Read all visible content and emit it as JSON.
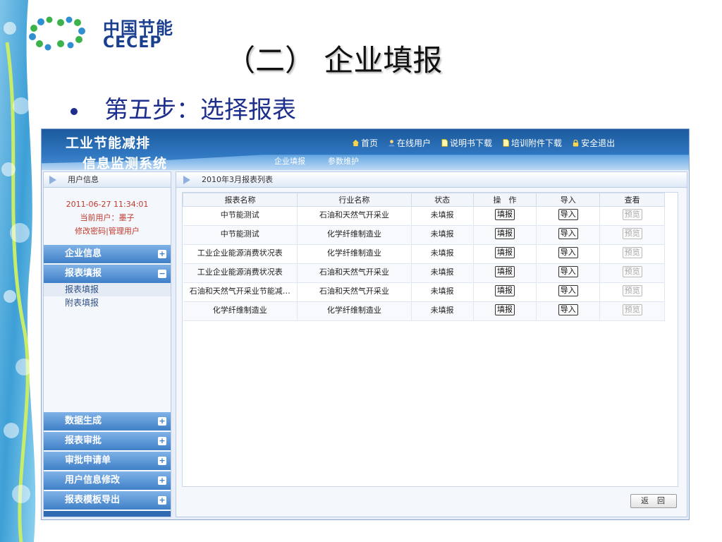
{
  "slide": {
    "logo_cn": "中国节能",
    "logo_en": "CECEP",
    "title": "（二） 企业填报",
    "bullet": "第五步：选择报表"
  },
  "app": {
    "title_line1": "工业节能减排",
    "title_line2": "信息监测系统",
    "nav": [
      {
        "label": "首页",
        "icon": "home-icon"
      },
      {
        "label": "在线用户",
        "icon": "user-icon"
      },
      {
        "label": "说明书下载",
        "icon": "document-icon"
      },
      {
        "label": "培训附件下载",
        "icon": "document-icon"
      },
      {
        "label": "安全退出",
        "icon": "lock-icon"
      }
    ],
    "menu_tabs": [
      "企业填报",
      "参数维护"
    ]
  },
  "sidebar": {
    "user_panel_title": "用户信息",
    "timestamp": "2011-06-27 11:34:01",
    "current_user": "当前用户：墨子",
    "change_password": "修改密码",
    "separator": "|",
    "manage_user": "管理用户",
    "sections_top": [
      {
        "label": "企业信息",
        "toggle": "+"
      },
      {
        "label": "报表填报",
        "toggle": "−"
      }
    ],
    "sub_items": [
      "报表填报",
      "附表填报"
    ],
    "sections_bottom": [
      {
        "label": "数据生成",
        "toggle": "+"
      },
      {
        "label": "报表审批",
        "toggle": "+"
      },
      {
        "label": "审批申请单",
        "toggle": "+"
      },
      {
        "label": "用户信息修改",
        "toggle": "+"
      },
      {
        "label": "报表模板导出",
        "toggle": "+"
      }
    ]
  },
  "content": {
    "panel_title": "2010年3月报表列表",
    "columns": [
      "报表名称",
      "行业名称",
      "状态",
      "操　作",
      "导入",
      "查看"
    ],
    "fill_label": "填报",
    "import_label": "导入",
    "preview_label": "预览",
    "rows": [
      {
        "name": "中节能测试",
        "industry": "石油和天然气开采业",
        "status": "未填报"
      },
      {
        "name": "中节能测试",
        "industry": "化学纤维制造业",
        "status": "未填报"
      },
      {
        "name": "工业企业能源消费状况表",
        "industry": "化学纤维制造业",
        "status": "未填报"
      },
      {
        "name": "工业企业能源消费状况表",
        "industry": "石油和天然气开采业",
        "status": "未填报"
      },
      {
        "name": "石油和天然气开采业节能减…",
        "industry": "石油和天然气开采业",
        "status": "未填报"
      },
      {
        "name": "化学纤维制造业",
        "industry": "化学纤维制造业",
        "status": "未填报"
      }
    ],
    "back_label": "返回"
  },
  "colors": {
    "header_blue": "#1c5a9c",
    "sidebar_section": "#3f7fc8",
    "user_info_red": "#c0392b",
    "bullet_blue": "#1c2f8c"
  }
}
